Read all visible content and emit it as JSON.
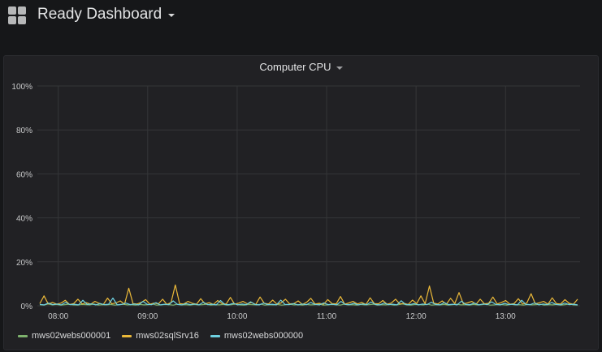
{
  "header": {
    "title": "Ready Dashboard",
    "icon": "dashboard-grid-icon"
  },
  "panel": {
    "title": "Computer CPU"
  },
  "chart_data": {
    "type": "line",
    "title": "Computer CPU",
    "ylim": [
      0,
      100
    ],
    "yticks": [
      "0%",
      "20%",
      "40%",
      "60%",
      "80%",
      "100%"
    ],
    "xticks": [
      "08:00",
      "09:00",
      "10:00",
      "11:00",
      "12:00",
      "13:00"
    ],
    "xlim": [
      "07:46",
      "13:50"
    ],
    "grid": true,
    "legend": "bottom-left",
    "series": [
      {
        "name": "mws02webs000001",
        "color": "#7eb26d",
        "values": [
          0.5,
          0.3,
          0.8,
          0.4,
          0.6,
          0.3,
          0.5,
          0.7,
          0.4,
          0.3,
          0.6,
          0.5,
          0.4,
          0.8,
          0.3,
          0.5,
          0.4,
          0.6,
          0.3,
          0.5,
          0.7,
          0.4,
          0.5,
          0.3,
          0.6,
          0.4,
          0.5,
          0.8,
          0.3,
          0.4,
          0.6,
          0.5,
          0.3,
          0.7,
          0.4,
          0.5,
          0.3,
          0.6,
          0.4,
          0.5,
          0.7,
          0.3,
          0.5,
          0.4,
          0.6,
          0.3,
          0.5,
          0.8,
          0.4,
          0.3,
          0.6,
          0.5,
          0.4,
          0.7,
          0.3,
          0.5,
          0.4,
          0.6,
          0.3,
          0.5,
          0.7,
          0.4,
          0.5,
          0.3,
          0.6,
          0.4,
          0.5,
          0.8,
          0.3,
          0.4,
          0.6,
          0.5,
          0.3,
          0.7,
          0.4,
          0.5,
          0.3,
          0.6,
          0.4,
          0.5,
          0.7,
          0.3,
          0.5,
          0.4,
          0.6,
          0.3,
          0.5,
          0.8,
          0.4,
          0.3,
          0.6,
          0.5,
          0.4,
          0.7,
          0.3,
          0.5,
          0.4,
          0.6,
          0.3,
          0.5,
          0.7,
          0.4,
          0.5,
          0.3,
          0.6,
          0.4,
          0.5,
          0.8,
          0.3,
          0.4,
          0.6,
          0.5,
          0.3,
          0.7,
          0.4,
          0.5,
          0.3,
          0.6,
          0.4,
          0.5,
          0.7,
          0.3,
          0.5,
          0.4,
          0.6,
          0.3,
          0.5,
          0.8,
          0.4,
          0.3
        ]
      },
      {
        "name": "mws02sqlSrv16",
        "color": "#eab839",
        "values": [
          1.0,
          4.5,
          0.8,
          1.5,
          0.7,
          1.2,
          2.5,
          0.6,
          1.0,
          3.0,
          0.8,
          1.4,
          0.7,
          2.0,
          1.1,
          0.6,
          3.5,
          0.9,
          1.3,
          2.2,
          0.7,
          8.0,
          1.0,
          0.8,
          1.6,
          2.8,
          0.7,
          1.2,
          0.9,
          3.0,
          0.6,
          1.5,
          9.5,
          1.0,
          0.8,
          2.0,
          1.1,
          0.7,
          3.2,
          0.9,
          1.4,
          0.6,
          2.4,
          1.0,
          0.8,
          3.8,
          0.7,
          1.2,
          2.0,
          0.9,
          1.5,
          0.6,
          4.0,
          1.1,
          0.8,
          2.6,
          0.7,
          1.3,
          3.0,
          0.9,
          1.0,
          2.2,
          0.6,
          1.6,
          3.4,
          0.8,
          1.1,
          0.7,
          2.8,
          1.0,
          0.9,
          4.2,
          0.7,
          1.3,
          2.0,
          0.8,
          1.5,
          0.6,
          3.6,
          1.0,
          0.9,
          2.4,
          0.7,
          1.2,
          3.0,
          0.8,
          1.1,
          0.6,
          2.6,
          1.0,
          4.5,
          0.9,
          9.0,
          1.2,
          0.8,
          2.2,
          0.7,
          3.4,
          1.0,
          6.0,
          0.9,
          1.3,
          2.0,
          0.7,
          3.0,
          0.9,
          1.1,
          4.0,
          0.8,
          1.5,
          2.4,
          0.7,
          1.0,
          3.2,
          0.8,
          1.2,
          5.5,
          0.9,
          1.4,
          2.0,
          0.7,
          3.6,
          1.0,
          0.8,
          2.8,
          1.1,
          0.7,
          3.0
        ]
      },
      {
        "name": "mws02webs000000",
        "color": "#6ed0e0",
        "values": [
          0.6,
          0.4,
          1.2,
          0.5,
          0.8,
          0.4,
          1.5,
          0.5,
          0.7,
          0.4,
          2.5,
          0.6,
          0.9,
          0.4,
          1.0,
          0.5,
          0.7,
          3.5,
          0.4,
          0.6,
          1.2,
          0.5,
          0.8,
          0.4,
          2.0,
          0.6,
          0.5,
          1.4,
          0.4,
          0.7,
          0.5,
          2.2,
          0.6,
          0.4,
          1.0,
          0.5,
          0.8,
          0.4,
          1.6,
          0.5,
          0.7,
          0.4,
          2.4,
          0.6,
          0.5,
          1.1,
          0.4,
          0.8,
          0.5,
          1.8,
          0.6,
          0.4,
          1.2,
          0.5,
          0.7,
          0.4,
          2.6,
          0.6,
          0.5,
          1.0,
          0.4,
          0.8,
          0.5,
          1.5,
          0.6,
          0.4,
          1.3,
          0.5,
          0.7,
          0.4,
          2.0,
          0.6,
          0.5,
          1.1,
          0.4,
          0.8,
          0.5,
          1.7,
          0.6,
          0.4,
          1.2,
          0.5,
          0.7,
          0.4,
          2.3,
          0.6,
          0.5,
          1.0,
          0.4,
          0.8,
          0.5,
          1.6,
          0.6,
          0.4,
          1.4,
          0.5,
          0.7,
          0.4,
          2.1,
          0.6,
          0.5,
          1.2,
          0.4,
          0.8,
          0.5,
          1.8,
          0.6,
          0.4,
          1.1,
          0.5,
          0.7,
          0.4,
          2.5,
          0.6,
          0.5,
          1.3,
          0.4,
          0.8,
          0.5,
          1.5,
          0.6,
          0.4,
          1.2,
          0.5,
          0.7,
          0.4
        ]
      }
    ]
  }
}
